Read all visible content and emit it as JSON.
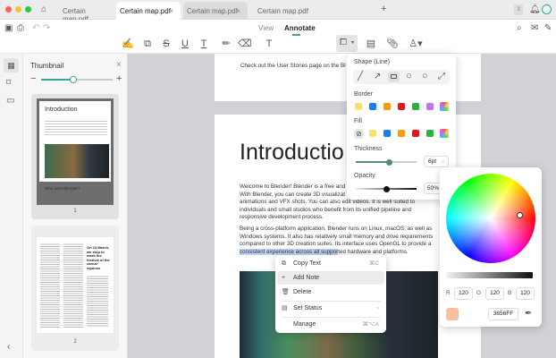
{
  "tabs": [
    {
      "label": "Certain map.pdf",
      "state": "normal"
    },
    {
      "label": "Certain map.pdf",
      "state": "active"
    },
    {
      "label": "Certain map.pdf",
      "state": "grey"
    },
    {
      "label": "Certain map.pdf",
      "state": "normal"
    }
  ],
  "tab_count": "3",
  "modes": {
    "view": "View",
    "annotate": "Annotate"
  },
  "accent": "#3aa693",
  "thumbnail": {
    "title": "Thumbnail",
    "zoom": 0.45,
    "pages": [
      {
        "label": "1",
        "title": "Introduction",
        "subtitle": "Who uses Blender?"
      },
      {
        "label": "2",
        "headline": "On 23 March, we stop to mark the festival of the carnal equinox"
      }
    ]
  },
  "doc": {
    "top_line": "Check out the User Stories page on the Bl",
    "heading": "Introductio",
    "para1": [
      "Welcome to Blender! Blender is a free and",
      "With Blender, you can create 3D visualizat",
      "animations and VFX shots. You can also edit videos. It is well suited to",
      "individuals and small studios who benefit from its unified pipeline and",
      "responsive development process."
    ],
    "para2": [
      "Being a cross-platform application, Blender runs on Linux, macOS, as well as",
      "Windows systems. It also has relatively small memory and drive requirements",
      "compared to other 3D creation suites. Its interface uses OpenGL to provide a"
    ],
    "para2_sel": "consistent experience across all suppor",
    "para2_rest": "ted hardware and platforms."
  },
  "shape_panel": {
    "shape_label": "Shape (Line)",
    "border_label": "Border",
    "border_colors": [
      "#f7e36a",
      "#1a7cf0",
      "#f79a0e",
      "#e8151b",
      "#27b340",
      "#c86ef0"
    ],
    "fill_label": "Fill",
    "fill_colors": [
      "#f7e36a",
      "#1a7cf0",
      "#f79a0e",
      "#e8151b",
      "#27b340"
    ],
    "thickness_label": "Thickness",
    "thickness_value": "6pt",
    "thickness_fraction": 0.55,
    "opacity_label": "Opacity",
    "opacity_value": "50%",
    "opacity_fraction": 0.5
  },
  "color_picker": {
    "r_label": "R",
    "r": "120",
    "g_label": "G",
    "g": "120",
    "b_label": "B",
    "b": "120",
    "hex": "3656FF",
    "preview_color": "#f8bfa0"
  },
  "context_menu": [
    {
      "label": "Copy Text",
      "shortcut": "⌘C",
      "icon": "copy-icon"
    },
    {
      "label": "Add Note",
      "shortcut": "",
      "icon": "plus-icon"
    },
    {
      "label": "Delete",
      "shortcut": "",
      "icon": "trash-icon"
    },
    {
      "label": "Set Status",
      "shortcut": "›",
      "icon": "status-icon"
    },
    {
      "label": "Manage",
      "shortcut": "⌘⌥A",
      "icon": ""
    }
  ]
}
